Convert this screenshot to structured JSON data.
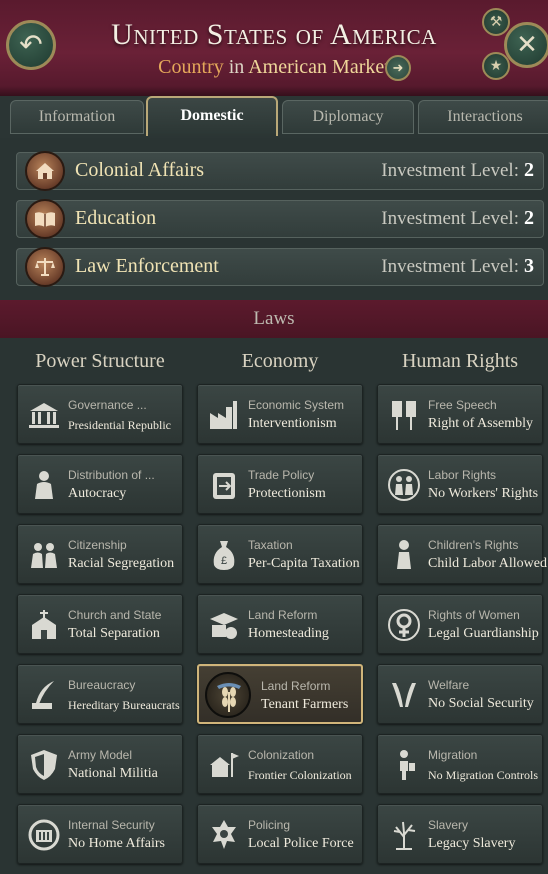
{
  "header": {
    "title": "United States of America",
    "subtitle_country": "Country",
    "subtitle_in": "in",
    "subtitle_market": "American Market",
    "back_icon": "back-arrow-icon",
    "close_icon": "close-icon"
  },
  "tabs": [
    {
      "label": "Information",
      "active": false
    },
    {
      "label": "Domestic",
      "active": true
    },
    {
      "label": "Diplomacy",
      "active": false
    },
    {
      "label": "Interactions",
      "active": false
    }
  ],
  "investments": {
    "level_label": "Investment Level:",
    "items": [
      {
        "name": "Colonial Affairs",
        "level": "2",
        "icon": "colonial-house-icon"
      },
      {
        "name": "Education",
        "level": "2",
        "icon": "book-icon"
      },
      {
        "name": "Law Enforcement",
        "level": "3",
        "icon": "scales-icon"
      }
    ]
  },
  "laws": {
    "banner": "Laws",
    "columns": [
      {
        "title": "Power Structure",
        "items": [
          {
            "category": "Governance ...",
            "value": "Presidential Republic",
            "icon": "capitol-icon"
          },
          {
            "category": "Distribution of ...",
            "value": "Autocracy",
            "icon": "ruler-icon"
          },
          {
            "category": "Citizenship",
            "value": "Racial Segregation",
            "icon": "citizens-icon"
          },
          {
            "category": "Church and State",
            "value": "Total Separation",
            "icon": "church-icon"
          },
          {
            "category": "Bureaucracy",
            "value": "Hereditary Bureaucrats",
            "icon": "bureaucrat-icon"
          },
          {
            "category": "Army Model",
            "value": "National Militia",
            "icon": "shield-icon"
          },
          {
            "category": "Internal Security",
            "value": "No Home Affairs",
            "icon": "security-seal-icon"
          }
        ]
      },
      {
        "title": "Economy",
        "items": [
          {
            "category": "Economic System",
            "value": "Interventionism",
            "icon": "factory-icon"
          },
          {
            "category": "Trade Policy",
            "value": "Protectionism",
            "icon": "trade-icon"
          },
          {
            "category": "Taxation",
            "value": "Per-Capita Taxation",
            "icon": "money-bag-icon"
          },
          {
            "category": "Land Reform",
            "value": "Homesteading",
            "icon": "land-deed-icon"
          },
          {
            "category": "Land Reform",
            "value": "Tenant Farmers",
            "icon": "wheat-hand-icon",
            "selected": true
          },
          {
            "category": "Colonization",
            "value": "Frontier Colonization",
            "icon": "colony-icon"
          },
          {
            "category": "Policing",
            "value": "Local Police Force",
            "icon": "police-badge-icon"
          }
        ]
      },
      {
        "title": "Human Rights",
        "items": [
          {
            "category": "Free Speech",
            "value": "Right of Assembly",
            "icon": "banners-icon"
          },
          {
            "category": "Labor Rights",
            "value": "No Workers' Rights",
            "icon": "workers-icon"
          },
          {
            "category": "Children's Rights",
            "value": "Child Labor Allowed",
            "icon": "child-icon"
          },
          {
            "category": "Rights of Women",
            "value": "Legal Guardianship",
            "icon": "female-symbol-icon"
          },
          {
            "category": "Welfare",
            "value": "No Social Security",
            "icon": "welfare-hands-icon"
          },
          {
            "category": "Migration",
            "value": "No Migration Controls",
            "icon": "migrant-icon"
          },
          {
            "category": "Slavery",
            "value": "Legacy Slavery",
            "icon": "tree-icon"
          }
        ]
      }
    ]
  }
}
